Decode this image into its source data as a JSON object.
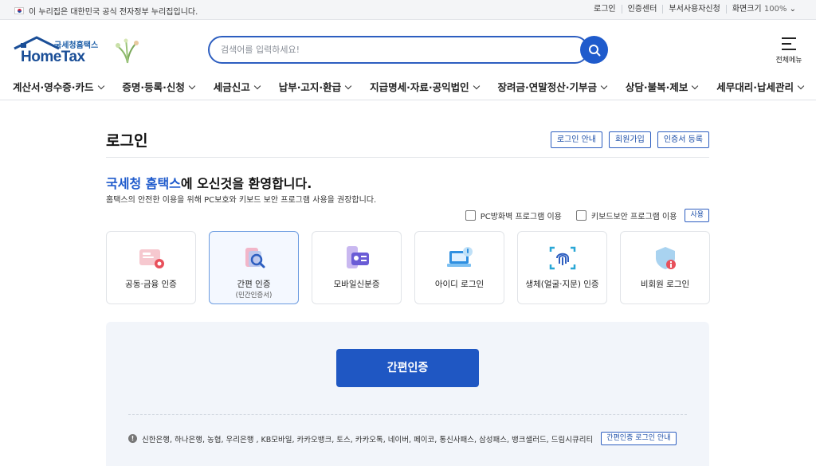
{
  "topbar": {
    "notice": "이 누리집은 대한민국 공식 전자정부 누리집입니다.",
    "links": [
      "로그인",
      "인증센터",
      "부서사용자신청"
    ],
    "zoom_label": "화면크기",
    "zoom_value": "100%"
  },
  "header": {
    "logo_sub": "국세청홈택스",
    "logo_main": "HomeTax",
    "search_placeholder": "검색어를 입력하세요!",
    "all_menu_label": "전체메뉴"
  },
  "gnb": [
    "계산서·영수증·카드",
    "증명·등록·신청",
    "세금신고",
    "납부·고지·환급",
    "지급명세·자료·공익법인",
    "장려금·연말정산·기부금",
    "상담·불복·제보",
    "세무대리·납세관리"
  ],
  "login": {
    "title": "로그인",
    "buttons": [
      "로그인 안내",
      "회원가입",
      "인증서 등록"
    ],
    "welcome_highlight": "국세청 홈택스",
    "welcome_rest": "에 오신것을 환영합니다.",
    "description": "홈택스의 안전한 이용을 위해 PC보호와 키보드 보안 프로그램 사용을 권장합니다.",
    "option_pc": "PC방화벽 프로그램 이용",
    "option_keyboard": "키보드보안 프로그램 이용",
    "use_button": "사용",
    "methods": [
      {
        "label": "공동·금융 인증",
        "sub": "",
        "icon": "certificate-icon"
      },
      {
        "label": "간편 인증",
        "sub": "(민간인증서)",
        "icon": "simple-auth-icon",
        "selected": true
      },
      {
        "label": "모바일신분증",
        "sub": "",
        "icon": "mobile-id-icon"
      },
      {
        "label": "아이디 로그인",
        "sub": "",
        "icon": "laptop-id-icon"
      },
      {
        "label": "생체(얼굴·지문) 인증",
        "sub": "",
        "icon": "fingerprint-icon"
      },
      {
        "label": "비회원 로그인",
        "sub": "",
        "icon": "shield-guest-icon"
      }
    ],
    "primary_button": "간편인증",
    "providers": "신한은행, 하나은행, 농협, 우리은행 , KB모바일, 카카오뱅크, 토스, 카카오톡, 네이버, 페이코, 통신사패스, 삼성패스, 뱅크샐러드, 드림시큐리티",
    "guide_button": "간편인증 로그인 안내"
  },
  "colors": {
    "brand": "#1f5bcc",
    "primary_button": "#1f57c3",
    "panel_bg": "#f2f5fa"
  }
}
